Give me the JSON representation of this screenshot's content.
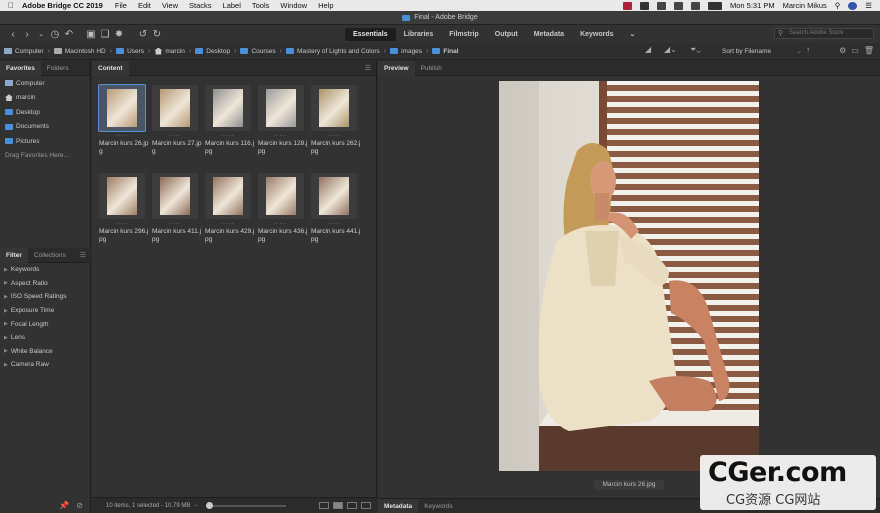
{
  "menubar": {
    "app_name": "Adobe Bridge CC 2019",
    "menus": [
      "File",
      "Edit",
      "View",
      "Stacks",
      "Label",
      "Tools",
      "Window",
      "Help"
    ],
    "clock": "Mon 5:31 PM",
    "user": "Marcin Mikus"
  },
  "window": {
    "title": "Final - Adobe Bridge"
  },
  "toolbar": {
    "workspaces": [
      "Essentials",
      "Libraries",
      "Filmstrip",
      "Output",
      "Metadata",
      "Keywords"
    ],
    "active_workspace": "Essentials",
    "stock_search_placeholder": "Search Adobe Stock"
  },
  "path": {
    "crumbs": [
      {
        "label": "Computer",
        "icon": "computer-icon"
      },
      {
        "label": "Macintosh HD",
        "icon": "disk-icon"
      },
      {
        "label": "Users",
        "icon": "folder-icon"
      },
      {
        "label": "marcin",
        "icon": "home-icon"
      },
      {
        "label": "Desktop",
        "icon": "folder-icon"
      },
      {
        "label": "Courses",
        "icon": "folder-icon"
      },
      {
        "label": "Mastery of Lights and Colors",
        "icon": "folder-icon"
      },
      {
        "label": "images",
        "icon": "folder-icon"
      },
      {
        "label": "Final",
        "icon": "folder-icon"
      }
    ],
    "sort_label": "Sort by Filename"
  },
  "favorites": {
    "tabs": [
      "Favorites",
      "Folders"
    ],
    "items": [
      {
        "label": "Computer",
        "icon": "computer-icon"
      },
      {
        "label": "marcin",
        "icon": "home-icon"
      },
      {
        "label": "Desktop",
        "icon": "folder-icon"
      },
      {
        "label": "Documents",
        "icon": "folder-icon"
      },
      {
        "label": "Pictures",
        "icon": "folder-icon"
      }
    ],
    "drag_hint": "Drag Favorites Here..."
  },
  "filter": {
    "tabs": [
      "Filter",
      "Collections"
    ],
    "items": [
      "Keywords",
      "Aspect Ratio",
      "ISO Speed Ratings",
      "Exposure Time",
      "Focal Length",
      "Lens",
      "White Balance",
      "Camera Raw"
    ]
  },
  "content": {
    "tab": "Content",
    "items": [
      {
        "name": "Marcin kurs 26.jpg",
        "tone": "#b89a72",
        "selected": true
      },
      {
        "name": "Marcin kurs 27.jpg",
        "tone": "#b59872",
        "selected": false
      },
      {
        "name": "Marcin kurs 116.jpg",
        "tone": "#8e8e8e",
        "selected": false
      },
      {
        "name": "Marcin kurs 128.jpg",
        "tone": "#9a9a9a",
        "selected": false
      },
      {
        "name": "Marcin kurs 262.jpg",
        "tone": "#a89468",
        "selected": false
      },
      {
        "name": "Marcin kurs 296.jpg",
        "tone": "#9c7c62",
        "selected": false
      },
      {
        "name": "Marcin kurs 411.jpg",
        "tone": "#8a6a58",
        "selected": false
      },
      {
        "name": "Marcin kurs 429.jpg",
        "tone": "#93735e",
        "selected": false
      },
      {
        "name": "Marcin kurs 436.jpg",
        "tone": "#9a7a66",
        "selected": false
      },
      {
        "name": "Marcin kurs 441.jpg",
        "tone": "#8f7260",
        "selected": false
      }
    ],
    "status": "10 items, 1 selected - 10.79 MB"
  },
  "preview": {
    "tabs": [
      "Preview",
      "Publish"
    ],
    "caption": "Marcin kurs 26.jpg",
    "meta_tabs": [
      "Metadata",
      "Keywords"
    ]
  },
  "watermark": {
    "title": "CGer.com",
    "subtitle": "CG资源 CG网站"
  },
  "colors": {
    "accent": "#4a90d9",
    "selection": "#5a8fd6",
    "panel": "#323232"
  }
}
